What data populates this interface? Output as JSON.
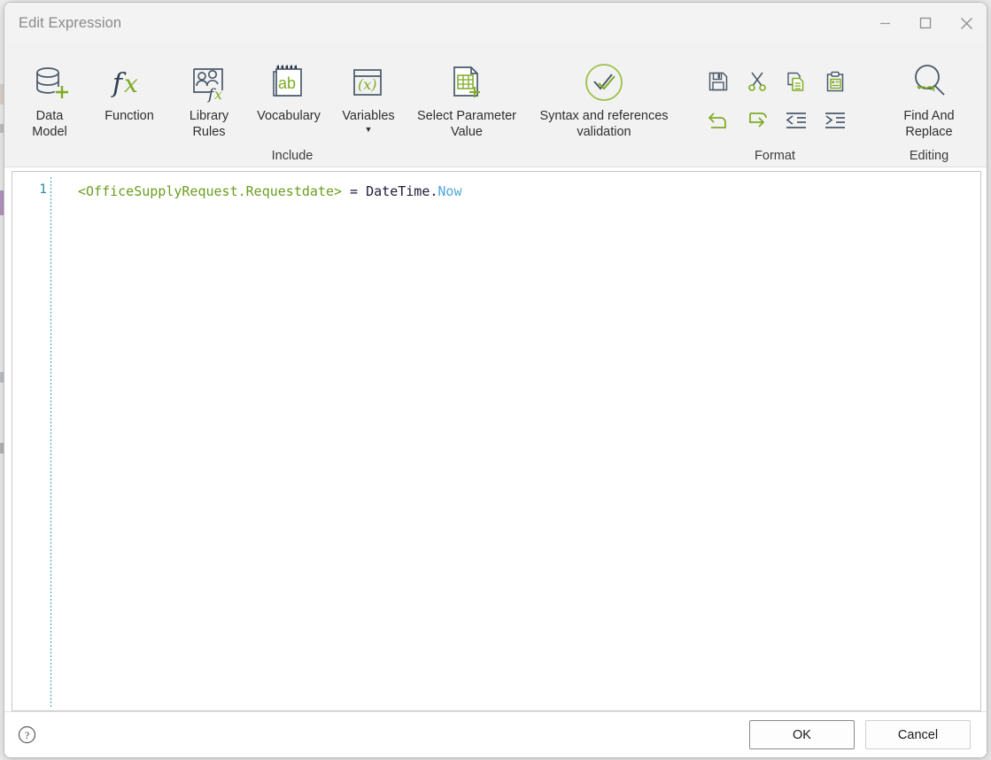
{
  "window": {
    "title": "Edit Expression",
    "controls": [
      {
        "name": "minimize",
        "glyph": "minimize-icon"
      },
      {
        "name": "maximize",
        "glyph": "maximize-icon"
      },
      {
        "name": "close",
        "glyph": "close-icon"
      }
    ]
  },
  "ribbon": {
    "groups": [
      {
        "label": "Include",
        "buttons": [
          {
            "label": "Data\nModel",
            "icon": "database-add-icon",
            "caret": false
          },
          {
            "label": "Function",
            "icon": "fx-icon",
            "caret": false
          },
          {
            "label": "Library\nRules",
            "icon": "library-rules-icon",
            "caret": false
          },
          {
            "label": "Vocabulary",
            "icon": "vocabulary-notepad-icon",
            "caret": false
          },
          {
            "label": "Variables",
            "icon": "variables-x-icon",
            "caret": true
          },
          {
            "label": "Select Parameter\nValue",
            "icon": "select-parameter-value-icon",
            "caret": false
          },
          {
            "label": "Syntax and references\nvalidation",
            "icon": "validation-check-icon",
            "caret": false
          }
        ]
      },
      {
        "label": "Format",
        "buttons": [
          {
            "label": "Save",
            "icon": "save-icon"
          },
          {
            "label": "Cut",
            "icon": "cut-icon"
          },
          {
            "label": "Copy",
            "icon": "copy-icon"
          },
          {
            "label": "Paste",
            "icon": "paste-icon"
          },
          {
            "label": "Undo",
            "icon": "undo-icon"
          },
          {
            "label": "Redo",
            "icon": "redo-icon"
          },
          {
            "label": "Decrease Indent",
            "icon": "outdent-icon"
          },
          {
            "label": "Increase Indent",
            "icon": "indent-icon"
          }
        ]
      },
      {
        "label": "Editing",
        "buttons": [
          {
            "label": "Find And\nReplace",
            "icon": "find-replace-icon",
            "caret": false
          }
        ]
      }
    ]
  },
  "editor": {
    "line_numbers": [
      "1"
    ],
    "lines": [
      {
        "tokens": [
          {
            "text": "<OfficeSupplyRequest.Requestdate>",
            "type": "field"
          },
          {
            "text": " = DateTime.",
            "type": "plain"
          },
          {
            "text": "Now",
            "type": "prop"
          }
        ]
      }
    ],
    "full_text": "<OfficeSupplyRequest.Requestdate> = DateTime.Now"
  },
  "footer": {
    "help_icon": "help-circle-icon",
    "ok_label": "OK",
    "cancel_label": "Cancel"
  },
  "colors": {
    "field": "#6a9e1f",
    "plain": "#1a1a3c",
    "property": "#4fa8d8",
    "line_number": "#2b8a9e",
    "icon_dark": "#4a5a6a",
    "icon_green": "#7faa24",
    "ribbon_bg": "#f2f2f2",
    "title_text": "#8a8a8a"
  }
}
